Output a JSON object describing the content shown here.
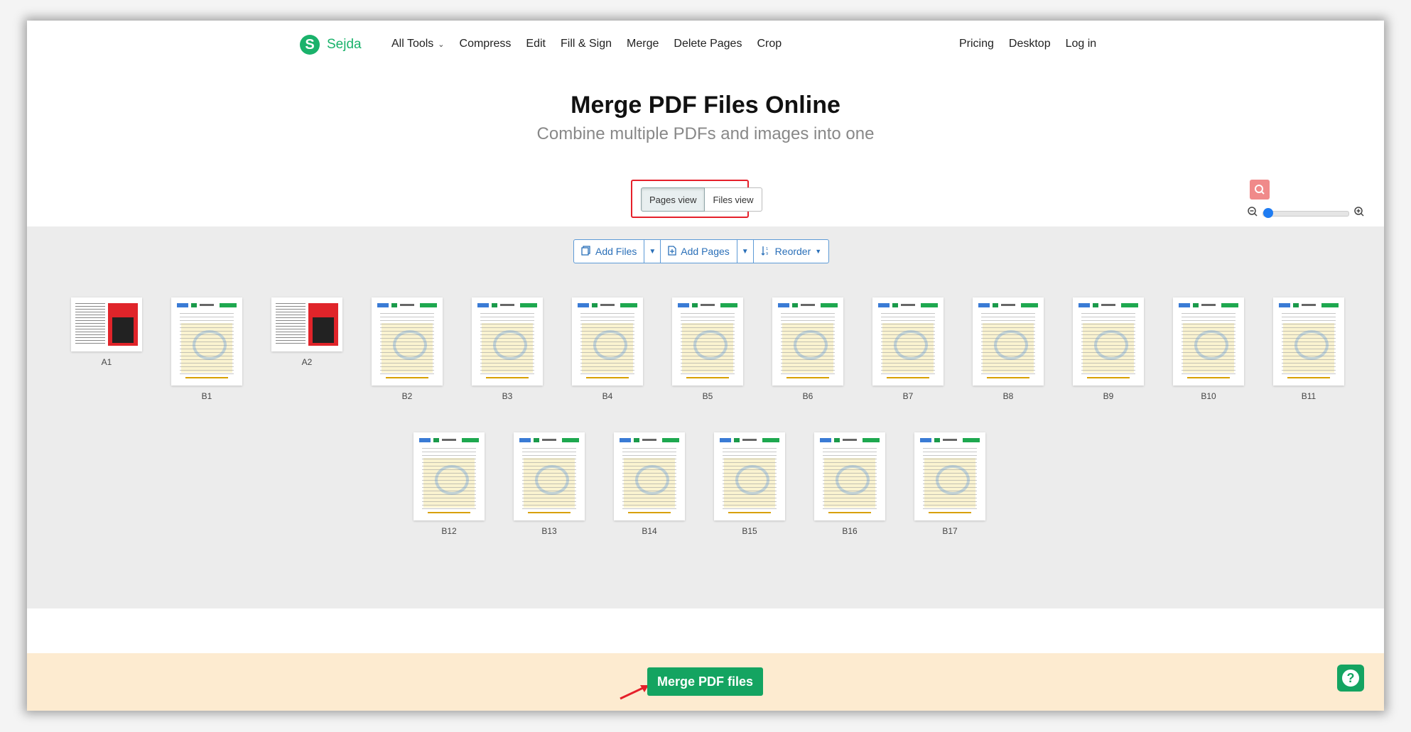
{
  "nav": {
    "logo_text": "Sejda",
    "logo_letter": "S",
    "links": [
      "All Tools",
      "Compress",
      "Edit",
      "Fill & Sign",
      "Merge",
      "Delete Pages",
      "Crop"
    ],
    "right_links": [
      "Pricing",
      "Desktop",
      "Log in"
    ]
  },
  "header": {
    "title": "Merge PDF Files Online",
    "subtitle": "Combine multiple PDFs and images into one"
  },
  "view_toggle": {
    "pages_view": "Pages view",
    "files_view": "Files view",
    "active": "Pages view"
  },
  "toolbar": {
    "add_files": "Add Files",
    "add_pages": "Add Pages",
    "reorder": "Reorder"
  },
  "pages": [
    {
      "label": "A1",
      "kind": "magazine"
    },
    {
      "label": "B1",
      "kind": "doc"
    },
    {
      "label": "A2",
      "kind": "magazine"
    },
    {
      "label": "B2",
      "kind": "doc"
    },
    {
      "label": "B3",
      "kind": "doc"
    },
    {
      "label": "B4",
      "kind": "doc"
    },
    {
      "label": "B5",
      "kind": "doc"
    },
    {
      "label": "B6",
      "kind": "doc"
    },
    {
      "label": "B7",
      "kind": "doc"
    },
    {
      "label": "B8",
      "kind": "doc"
    },
    {
      "label": "B9",
      "kind": "doc"
    },
    {
      "label": "B10",
      "kind": "doc"
    },
    {
      "label": "B11",
      "kind": "doc"
    },
    {
      "label": "B12",
      "kind": "doc"
    },
    {
      "label": "B13",
      "kind": "doc"
    },
    {
      "label": "B14",
      "kind": "doc"
    },
    {
      "label": "B15",
      "kind": "doc"
    },
    {
      "label": "B16",
      "kind": "doc"
    },
    {
      "label": "B17",
      "kind": "doc"
    }
  ],
  "footer": {
    "merge_button": "Merge PDF files"
  },
  "colors": {
    "brand_green": "#14a461",
    "highlight_red": "#e5202a",
    "link_blue": "#2a6fb8",
    "footer_bg": "#fdebd0"
  },
  "icons": [
    "chevron-down-icon",
    "search-icon",
    "zoom-out-icon",
    "zoom-in-icon",
    "add-files-icon",
    "add-pages-icon",
    "reorder-icon",
    "help-icon",
    "arrow-icon"
  ]
}
